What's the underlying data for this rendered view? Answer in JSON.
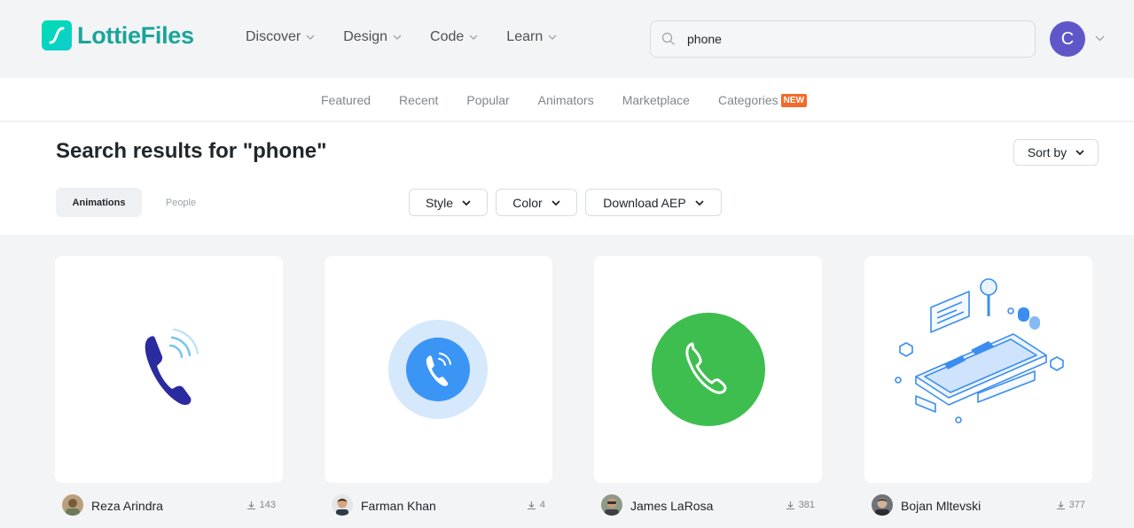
{
  "brand": {
    "name": "LottieFiles"
  },
  "nav": [
    {
      "label": "Discover"
    },
    {
      "label": "Design"
    },
    {
      "label": "Code"
    },
    {
      "label": "Learn"
    }
  ],
  "search": {
    "value": "phone"
  },
  "user": {
    "initial": "C",
    "color": "#5f57c9"
  },
  "subnav": {
    "items": [
      "Featured",
      "Recent",
      "Popular",
      "Animators",
      "Marketplace",
      "Categories"
    ],
    "new_badge": "NEW"
  },
  "results": {
    "title": "Search results for \"phone\"",
    "sort_label": "Sort by",
    "tabs": {
      "active": "Animations",
      "other": "People"
    },
    "filters": [
      "Style",
      "Color",
      "Download AEP"
    ]
  },
  "cards": [
    {
      "author": "Reza Arindra",
      "downloads": "143",
      "icon": "phone-ringing-icon"
    },
    {
      "author": "Farman Khan",
      "downloads": "4",
      "icon": "phone-circle-blue-icon"
    },
    {
      "author": "James LaRosa",
      "downloads": "381",
      "icon": "phone-circle-green-icon"
    },
    {
      "author": "Bojan Mltevski",
      "downloads": "377",
      "icon": "isometric-phone-repair-icon"
    }
  ],
  "colors": {
    "accent_teal": "#1aa59a",
    "new_badge": "#f26b2a",
    "phone_green": "#3dbe4f",
    "phone_blue": "#3b95f5"
  }
}
